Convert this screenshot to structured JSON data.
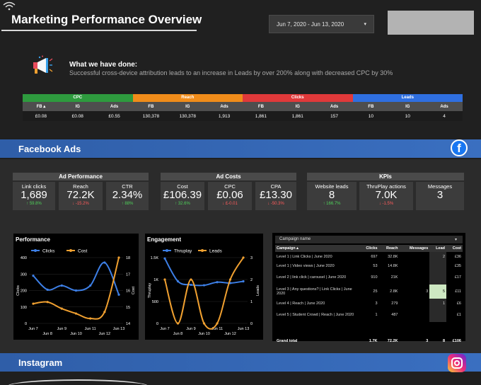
{
  "header": {
    "title": "Marketing Performance Overview",
    "date_range": "Jun 7, 2020 - Jun 13, 2020"
  },
  "summary_text": {
    "title": "What we have done:",
    "description": "Successful cross-device attribution leads to an increase in Leads by over 200% along with decreased CPC by 30%"
  },
  "summary_table": [
    {
      "name": "CPC",
      "color": "#2e9b3e",
      "cols": [
        "FB ▴",
        "IG",
        "Ads"
      ],
      "vals": [
        "£0.08",
        "£0.08",
        "£0.55"
      ]
    },
    {
      "name": "Reach",
      "color": "#f08c1a",
      "cols": [
        "FB",
        "IG",
        "Ads"
      ],
      "vals": [
        "130,378",
        "130,378",
        "1,913"
      ]
    },
    {
      "name": "Clicks",
      "color": "#e0393a",
      "cols": [
        "FB",
        "IG",
        "Ads"
      ],
      "vals": [
        "1,861",
        "1,861",
        "157"
      ]
    },
    {
      "name": "Leads",
      "color": "#2f6fe0",
      "cols": [
        "FB",
        "IG",
        "Ads"
      ],
      "vals": [
        "10",
        "10",
        "4"
      ]
    }
  ],
  "sections": {
    "facebook": "Facebook Ads",
    "instagram": "Instagram"
  },
  "kpis": {
    "ad_performance": {
      "title": "Ad Performance",
      "cards": [
        {
          "label": "Link clicks",
          "value": "1,689",
          "delta": "↑ 59.8%",
          "dir": "up"
        },
        {
          "label": "Reach",
          "value": "72.2K",
          "delta": "↓ -15.2%",
          "dir": "down"
        },
        {
          "label": "CTR",
          "value": "2.34%",
          "delta": "↑ 88%",
          "dir": "up"
        }
      ]
    },
    "ad_costs": {
      "title": "Ad Costs",
      "cards": [
        {
          "label": "Cost",
          "value": "£106.39",
          "delta": "↑ 32.6%",
          "dir": "up"
        },
        {
          "label": "CPC",
          "value": "£0.06",
          "delta": "↓ £-0.01",
          "dir": "down"
        },
        {
          "label": "CPA",
          "value": "£13.30",
          "delta": "↓ -50.3%",
          "dir": "down"
        }
      ]
    },
    "kpis": {
      "title": "KPIs",
      "cards": [
        {
          "label": "Website leads",
          "value": "8",
          "delta": "↑ 166.7%",
          "dir": "up"
        },
        {
          "label": "ThruPlay actions",
          "value": "7.0K",
          "delta": "↓ -1.5%",
          "dir": "down"
        },
        {
          "label": "Messages",
          "value": "3",
          "delta": "",
          "dir": "none"
        }
      ]
    }
  },
  "chart_data": [
    {
      "type": "line",
      "title": "Performance",
      "x": [
        "Jun 7",
        "Jun 8",
        "Jun 9",
        "Jun 10",
        "Jun 11",
        "Jun 12",
        "Jun 13"
      ],
      "series": [
        {
          "name": "Clicks",
          "axis": "left",
          "color": "#3d7fe6",
          "values": [
            290,
            205,
            230,
            200,
            230,
            370,
            175
          ]
        },
        {
          "name": "Cost",
          "axis": "right",
          "color": "#f0a030",
          "values": [
            15.2,
            15.3,
            14.9,
            14.6,
            14.3,
            14.7,
            18
          ]
        }
      ],
      "ylabel": "Clicks",
      "y2label": "Cost",
      "ylim": [
        0,
        400
      ],
      "y2lim": [
        14,
        18
      ],
      "yticks": [
        "400",
        "300",
        "200",
        "100",
        "0"
      ],
      "y2ticks": [
        "18",
        "17",
        "16",
        "15",
        "14"
      ]
    },
    {
      "type": "line",
      "title": "Engagement",
      "x": [
        "Jun 7",
        "Jun 8",
        "Jun 9",
        "Jun 10",
        "Jun 11",
        "Jun 12",
        "Jun 13"
      ],
      "series": [
        {
          "name": "Thruplay",
          "axis": "left",
          "color": "#3d7fe6",
          "values": [
            1480,
            960,
            880,
            870,
            940,
            920,
            960
          ]
        },
        {
          "name": "Leads",
          "axis": "right",
          "color": "#f0a030",
          "values": [
            2,
            0,
            2,
            0,
            0,
            2,
            3
          ]
        }
      ],
      "ylabel": "Thruplay",
      "y2label": "Leads",
      "ylim": [
        0,
        1500
      ],
      "y2lim": [
        0,
        3
      ],
      "yticks": [
        "1.5K",
        "1K",
        "500",
        "0"
      ],
      "y2ticks": [
        "3",
        "2",
        "1",
        "0"
      ]
    }
  ],
  "campaign_table": {
    "filter_label": "Campaign name",
    "headers": [
      "Campaign ▴",
      "Clicks",
      "Reach",
      "Messages",
      "Lead",
      "Cost"
    ],
    "rows": [
      {
        "name": "Level 1 | Link Clicks | June 2020",
        "clicks": "697",
        "reach": "32.8K",
        "messages": "",
        "lead": "2",
        "cost": "£36"
      },
      {
        "name": "Level 1 | Video views | June 2020",
        "clicks": "53",
        "reach": "14.8K",
        "messages": "",
        "lead": "",
        "cost": "£35"
      },
      {
        "name": "Level 2 | link click | carousel | June 2020",
        "clicks": "910",
        "reach": "21K",
        "messages": "",
        "lead": "",
        "cost": "£17"
      },
      {
        "name": "Level 3 | Any questions? | Link Clicks | June 2020",
        "clicks": "25",
        "reach": "2.8K",
        "messages": "3",
        "lead": "5",
        "cost": "£11"
      },
      {
        "name": "Level 4 | Reach | June 2020",
        "clicks": "3",
        "reach": "279",
        "messages": "",
        "lead": "1",
        "cost": "£6"
      },
      {
        "name": "Level 5 | Student Crowd | Reach | June 2020",
        "clicks": "1",
        "reach": "487",
        "messages": "",
        "lead": "",
        "cost": "£1"
      }
    ],
    "total": {
      "name": "Grand total",
      "clicks": "1.7K",
      "reach": "72.2K",
      "messages": "3",
      "lead": "8",
      "cost": "£106"
    }
  }
}
